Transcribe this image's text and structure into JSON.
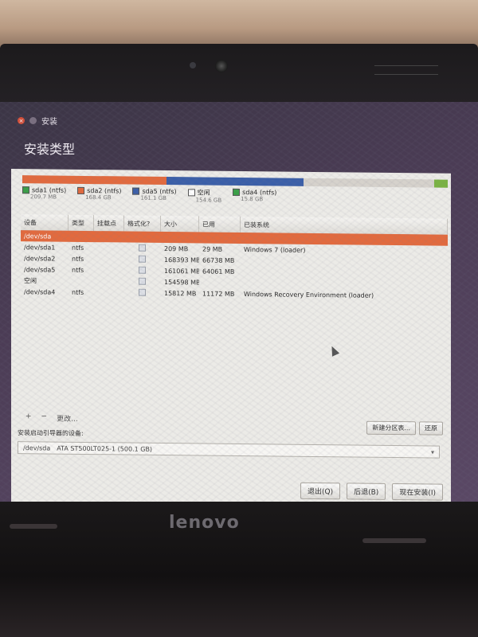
{
  "window": {
    "title": "安装",
    "heading": "安装类型"
  },
  "partition_bar": {
    "segments": [
      {
        "name": "sda1 (ntfs)",
        "color": "#e26a3e",
        "fraction": 0.0014
      },
      {
        "name": "sda2 (ntfs)",
        "color": "#e26a3e",
        "fraction": 0.337
      },
      {
        "name": "sda5 (ntfs)",
        "color": "#3b5fa8",
        "fraction": 0.322
      },
      {
        "name": "空闲",
        "color": "#d6d2cc",
        "fraction": 0.309
      },
      {
        "name": "sda4 (ntfs)",
        "color": "#7ab342",
        "fraction": 0.031
      }
    ]
  },
  "legend": [
    {
      "name": "sda1 (ntfs)",
      "size": "209.7 MB",
      "color": "#3aa047"
    },
    {
      "name": "sda2 (ntfs)",
      "size": "168.4 GB",
      "color": "#e26a3e"
    },
    {
      "name": "sda5 (ntfs)",
      "size": "161.1 GB",
      "color": "#3b5fa8"
    },
    {
      "name": "空闲",
      "size": "154.6 GB",
      "color": "#ffffff"
    },
    {
      "name": "sda4 (ntfs)",
      "size": "15.8 GB",
      "color": "#3aa047"
    }
  ],
  "table": {
    "headers": [
      "设备",
      "类型",
      "挂载点",
      "格式化?",
      "大小",
      "已用",
      "已装系统"
    ],
    "rows": [
      {
        "device": "/dev/sda",
        "type": "",
        "mount": "",
        "format": false,
        "size": "",
        "used": "",
        "system": "",
        "group": true
      },
      {
        "device": "/dev/sda1",
        "type": "ntfs",
        "mount": "",
        "format": false,
        "size": "209 MB",
        "used": "29 MB",
        "system": "Windows 7 (loader)",
        "group": false
      },
      {
        "device": "/dev/sda2",
        "type": "ntfs",
        "mount": "",
        "format": false,
        "size": "168393 MB",
        "used": "66738 MB",
        "system": "",
        "group": false
      },
      {
        "device": "/dev/sda5",
        "type": "ntfs",
        "mount": "",
        "format": false,
        "size": "161061 MB",
        "used": "64061 MB",
        "system": "",
        "group": false
      },
      {
        "device": "空闲",
        "type": "",
        "mount": "",
        "format": false,
        "size": "154598 MB",
        "used": "",
        "system": "",
        "group": false
      },
      {
        "device": "/dev/sda4",
        "type": "ntfs",
        "mount": "",
        "format": false,
        "size": "15812 MB",
        "used": "11172 MB",
        "system": "Windows Recovery Environment (loader)",
        "group": false
      }
    ]
  },
  "table_actions": {
    "add": "+",
    "remove": "−",
    "change": "更改...",
    "new_partition_table": "新建分区表...",
    "revert": "还原"
  },
  "boot_loader": {
    "label": "安装启动引导器的设备:",
    "device": "/dev/sda",
    "description": "ATA ST500LT025-1 (500.1 GB)"
  },
  "buttons": {
    "quit": "退出(Q)",
    "back": "后退(B)",
    "install_now": "现在安装(I)"
  },
  "hardware": {
    "brand": "lenovo"
  }
}
